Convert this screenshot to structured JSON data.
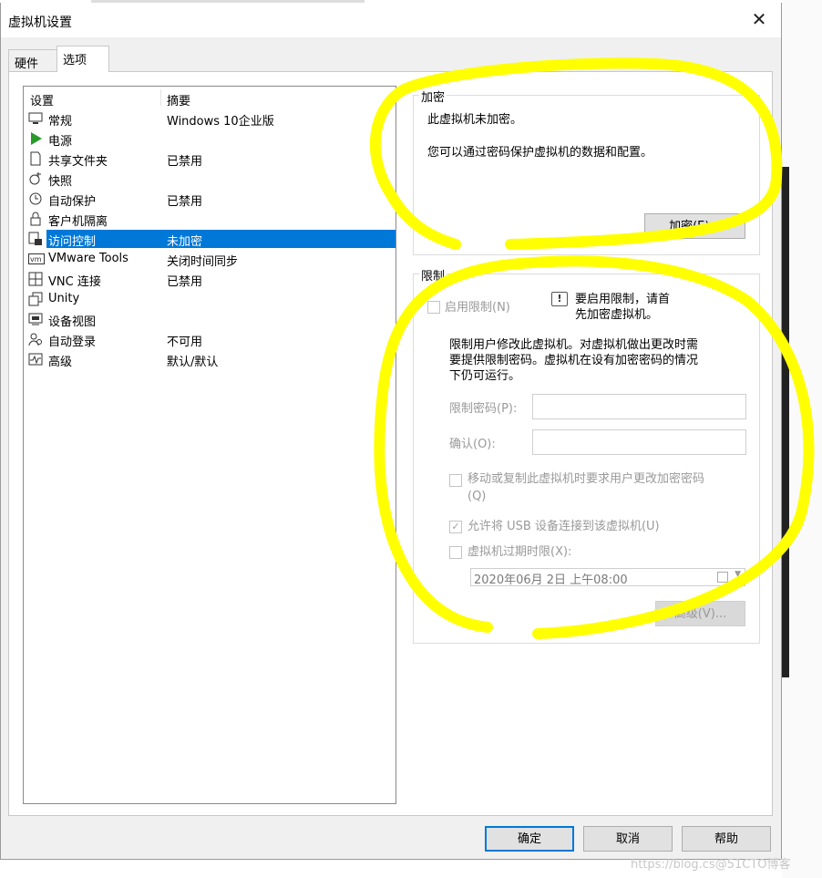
{
  "window": {
    "title": "虚拟机设置",
    "close_glyph": "✕"
  },
  "tabs": [
    {
      "label": "硬件"
    },
    {
      "label": "选项"
    }
  ],
  "list": {
    "headers": {
      "setting": "设置",
      "summary": "摘要"
    },
    "items": [
      {
        "label": "常规",
        "value": "Windows 10企业版",
        "icon": "monitor-icon"
      },
      {
        "label": "电源",
        "value": "",
        "icon": "power-play-icon"
      },
      {
        "label": "共享文件夹",
        "value": "已禁用",
        "icon": "shared-folder-icon"
      },
      {
        "label": "快照",
        "value": "",
        "icon": "snapshot-icon"
      },
      {
        "label": "自动保护",
        "value": "已禁用",
        "icon": "clock-icon"
      },
      {
        "label": "客户机隔离",
        "value": "",
        "icon": "lock-icon"
      },
      {
        "label": "访问控制",
        "value": "未加密",
        "icon": "access-control-icon",
        "selected": true
      },
      {
        "label": "VMware Tools",
        "value": "关闭时间同步",
        "icon": "vm-icon"
      },
      {
        "label": "VNC 连接",
        "value": "已禁用",
        "icon": "vnc-icon"
      },
      {
        "label": "Unity",
        "value": "",
        "icon": "unity-icon"
      },
      {
        "label": "设备视图",
        "value": "",
        "icon": "device-view-icon"
      },
      {
        "label": "自动登录",
        "value": "不可用",
        "icon": "user-icon"
      },
      {
        "label": "高级",
        "value": "默认/默认",
        "icon": "advanced-icon"
      }
    ]
  },
  "encryption": {
    "title": "加密",
    "status": "此虚拟机未加密。",
    "description": "您可以通过密码保护虚拟机的数据和配置。",
    "button": "加密(E)..."
  },
  "restrictions": {
    "title": "限制",
    "enable_label": "启用限制(N)",
    "info_line1": "要启用限制，请首",
    "info_line2": "先加密虚拟机。",
    "desc_line1": "限制用户修改此虚拟机。对虚拟机做出更改时需",
    "desc_line2": "要提供限制密码。虚拟机在设有加密密码的情况",
    "desc_line3": "下仍可运行。",
    "password_label": "限制密码(P):",
    "confirm_label": "确认(O):",
    "require_change_line1": "移动或复制此虚拟机时要求用户更改加密密码",
    "require_change_line2": "(Q)",
    "allow_usb": "允许将 USB 设备连接到该虚拟机(U)",
    "expire_label": "虚拟机过期时限(X):",
    "expire_date": "2020年06月  2日  上午08:00",
    "advanced_button": "高级(V)..."
  },
  "footer": {
    "ok": "确定",
    "cancel": "取消",
    "help": "帮助"
  },
  "watermark": "https://blog.cs@51CTO博客",
  "colors": {
    "selection": "#0078d7",
    "highlight": "#ffff00",
    "power": "#2a9a2a"
  }
}
